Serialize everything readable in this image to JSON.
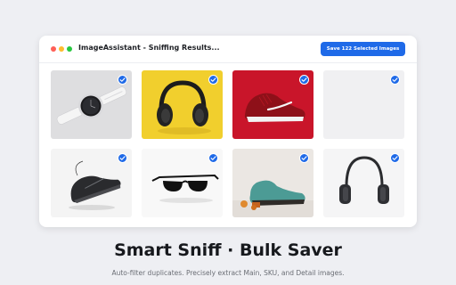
{
  "window": {
    "title": "ImageAssistant - Sniffing Results...",
    "save_button_label": "Save 122 Selected Images"
  },
  "gallery": {
    "items": [
      {
        "subject": "smartwatch",
        "background": "#dedee0",
        "selected": true
      },
      {
        "subject": "headphones",
        "background": "#f1cf2d",
        "selected": true
      },
      {
        "subject": "red sneaker",
        "background": "#c9152a",
        "selected": true
      },
      {
        "subject": "empty",
        "background": "#f0f0f2",
        "selected": true
      },
      {
        "subject": "black sneaker",
        "background": "#f4f4f4",
        "selected": true
      },
      {
        "subject": "sunglasses",
        "background": "#f8f8f8",
        "selected": true
      },
      {
        "subject": "teal shoe",
        "background": "#ebe7e3",
        "selected": true
      },
      {
        "subject": "over-ear headphones",
        "background": "#f5f5f6",
        "selected": true
      }
    ]
  },
  "hero": {
    "headline": "Smart Sniff · Bulk Saver",
    "subline": "Auto-filter duplicates. Precisely extract Main, SKU, and Detail images."
  },
  "colors": {
    "accent": "#1f6ae8",
    "page_background": "#eeeff3",
    "window_background": "#ffffff"
  }
}
